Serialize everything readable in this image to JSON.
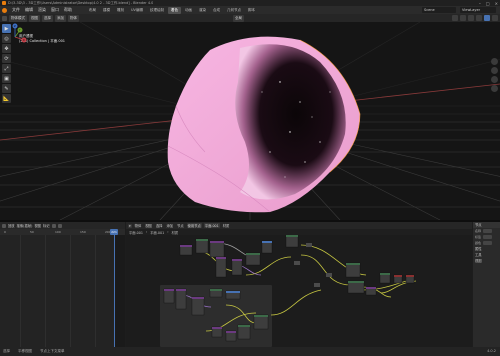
{
  "window": {
    "title": "D:\\3-3D\\3 - 3D工作\\Users\\Administrator\\Desktop\\4.0 2 - 3D工作.blend] - Blender 4.0",
    "controls": [
      "–",
      "□",
      "×"
    ]
  },
  "menubar": {
    "menus": [
      "文件",
      "编辑",
      "渲染",
      "窗口",
      "帮助"
    ],
    "workspaces": [
      "布局",
      "建模",
      "雕刻",
      "UV编辑",
      "纹理绘制",
      "着色",
      "动画",
      "渲染",
      "合成",
      "几何节点",
      "脚本"
    ],
    "active_workspace": "着色",
    "scene": "Scene",
    "view_layer": "ViewLayer"
  },
  "viewport_header": {
    "mode": "物体模式",
    "menus": [
      "视图",
      "选择",
      "添加",
      "物体"
    ],
    "transform": "全局"
  },
  "viewport": {
    "info_line1": "用户透视",
    "info_line2": "(221) Collection | 平面.001",
    "tools": [
      "▶",
      "◎",
      "✥",
      "⟳",
      "⤢",
      "▣",
      "✎",
      "📐"
    ],
    "gizmo": {
      "x": "X",
      "y": "Y",
      "z": "Z"
    }
  },
  "timeline": {
    "header": [
      "回放",
      "抠像(插帧)",
      "视图",
      "标记"
    ],
    "ruler_ticks": [
      "0",
      "50",
      "100",
      "150",
      "200"
    ],
    "current_frame": "221"
  },
  "node_editor": {
    "header": [
      "物体",
      "视图",
      "选择",
      "添加",
      "节点",
      "使用节点"
    ],
    "material": "平面.001",
    "slot": "材质",
    "breadcrumb": [
      "平面.001",
      "平面.001",
      "材质"
    ]
  },
  "properties": {
    "tabs": [
      "节点",
      "名称",
      "标签",
      "工具",
      "视图"
    ],
    "rows": [
      {
        "label": "名称"
      },
      {
        "label": "标签"
      },
      {
        "label": "颜色"
      }
    ],
    "section": "属性"
  },
  "statusbar": {
    "left": [
      "选择",
      "平移视图",
      "节点上下文菜单"
    ],
    "right": "4.0.2"
  },
  "colors": {
    "accent": "#4772b3",
    "object_pink": "#f4a8d8",
    "node_wire": "#c7c742",
    "node_frame": "#2d2d2d"
  }
}
